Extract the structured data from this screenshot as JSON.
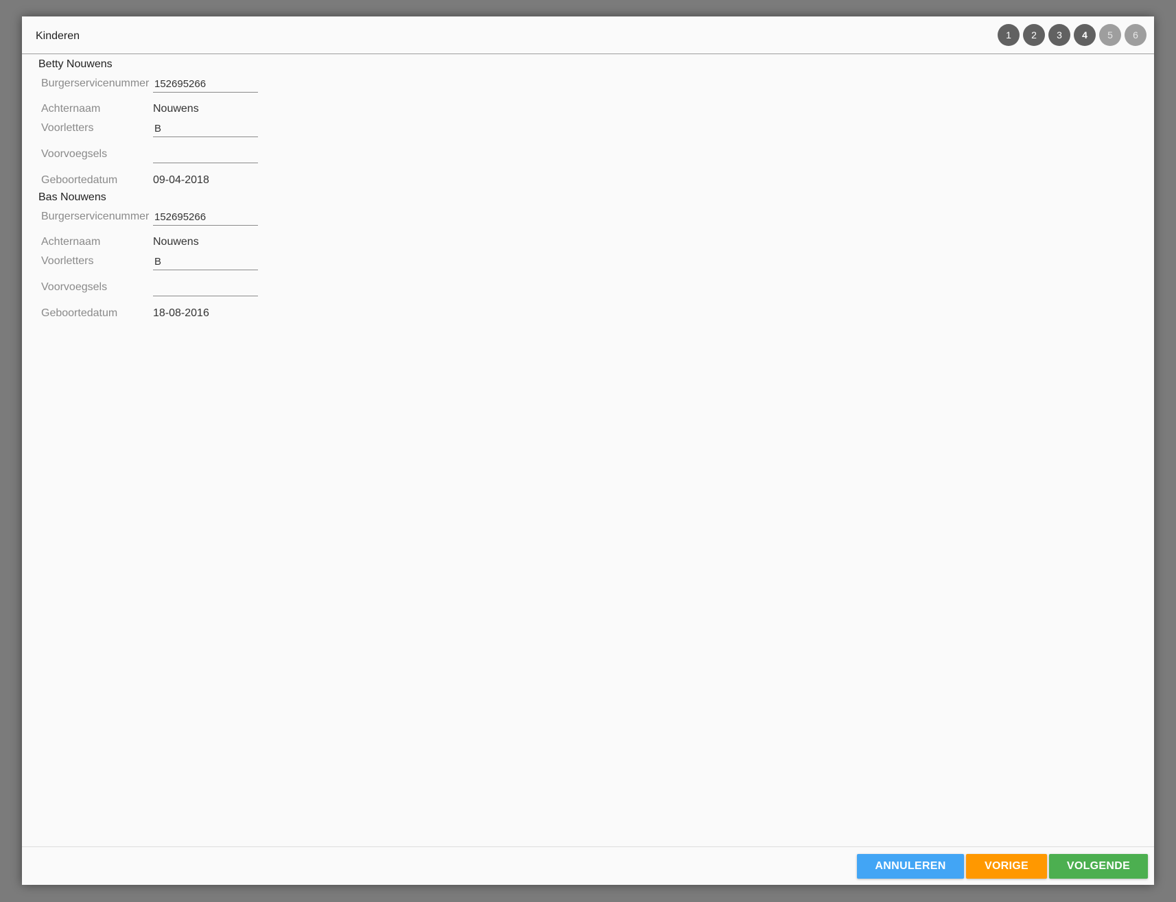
{
  "dialog": {
    "title": "Kinderen"
  },
  "steps": [
    {
      "label": "1",
      "state": "done"
    },
    {
      "label": "2",
      "state": "done"
    },
    {
      "label": "3",
      "state": "done"
    },
    {
      "label": "4",
      "state": "current"
    },
    {
      "label": "5",
      "state": "future"
    },
    {
      "label": "6",
      "state": "future"
    }
  ],
  "children": [
    {
      "name": "Betty Nouwens",
      "bsn_label": "Burgerservicenummer",
      "bsn_value": "152695266",
      "achternaam_label": "Achternaam",
      "achternaam_value": "Nouwens",
      "voorletters_label": "Voorletters",
      "voorletters_value": "B",
      "voorvoegsels_label": "Voorvoegsels",
      "voorvoegsels_value": "",
      "geboortedatum_label": "Geboortedatum",
      "geboortedatum_value": "09-04-2018"
    },
    {
      "name": "Bas Nouwens",
      "bsn_label": "Burgerservicenummer",
      "bsn_value": "152695266",
      "achternaam_label": "Achternaam",
      "achternaam_value": "Nouwens",
      "voorletters_label": "Voorletters",
      "voorletters_value": "B",
      "voorvoegsels_label": "Voorvoegsels",
      "voorvoegsels_value": "",
      "geboortedatum_label": "Geboortedatum",
      "geboortedatum_value": "18-08-2016"
    }
  ],
  "footer": {
    "cancel_label": "ANNULEREN",
    "prev_label": "VORIGE",
    "next_label": "VOLGENDE"
  },
  "colors": {
    "cancel": "#42a5f5",
    "prev": "#ff9800",
    "next": "#4caf50",
    "step_done": "#616161",
    "step_future": "#9e9e9e"
  }
}
